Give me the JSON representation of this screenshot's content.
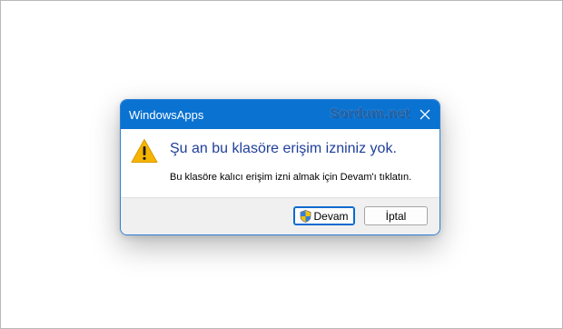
{
  "dialog": {
    "title": "WindowsApps",
    "watermark": "Sordum.net",
    "close_icon": "close-icon",
    "main_instruction": "Şu an bu klasöre erişim izniniz yok.",
    "sub_text": "Bu klasöre kalıcı erişim izni almak için Devam'ı tıklatın.",
    "warning_icon": "warning-icon",
    "buttons": {
      "continue_label": "Devam",
      "continue_icon": "uac-shield-icon",
      "cancel_label": "İptal"
    }
  },
  "colors": {
    "titlebar": "#0a72d1",
    "title_text": "#ffffff",
    "main_instruction": "#1f3f9a",
    "footer": "#f0f0f0",
    "warning": "#f6b400"
  }
}
